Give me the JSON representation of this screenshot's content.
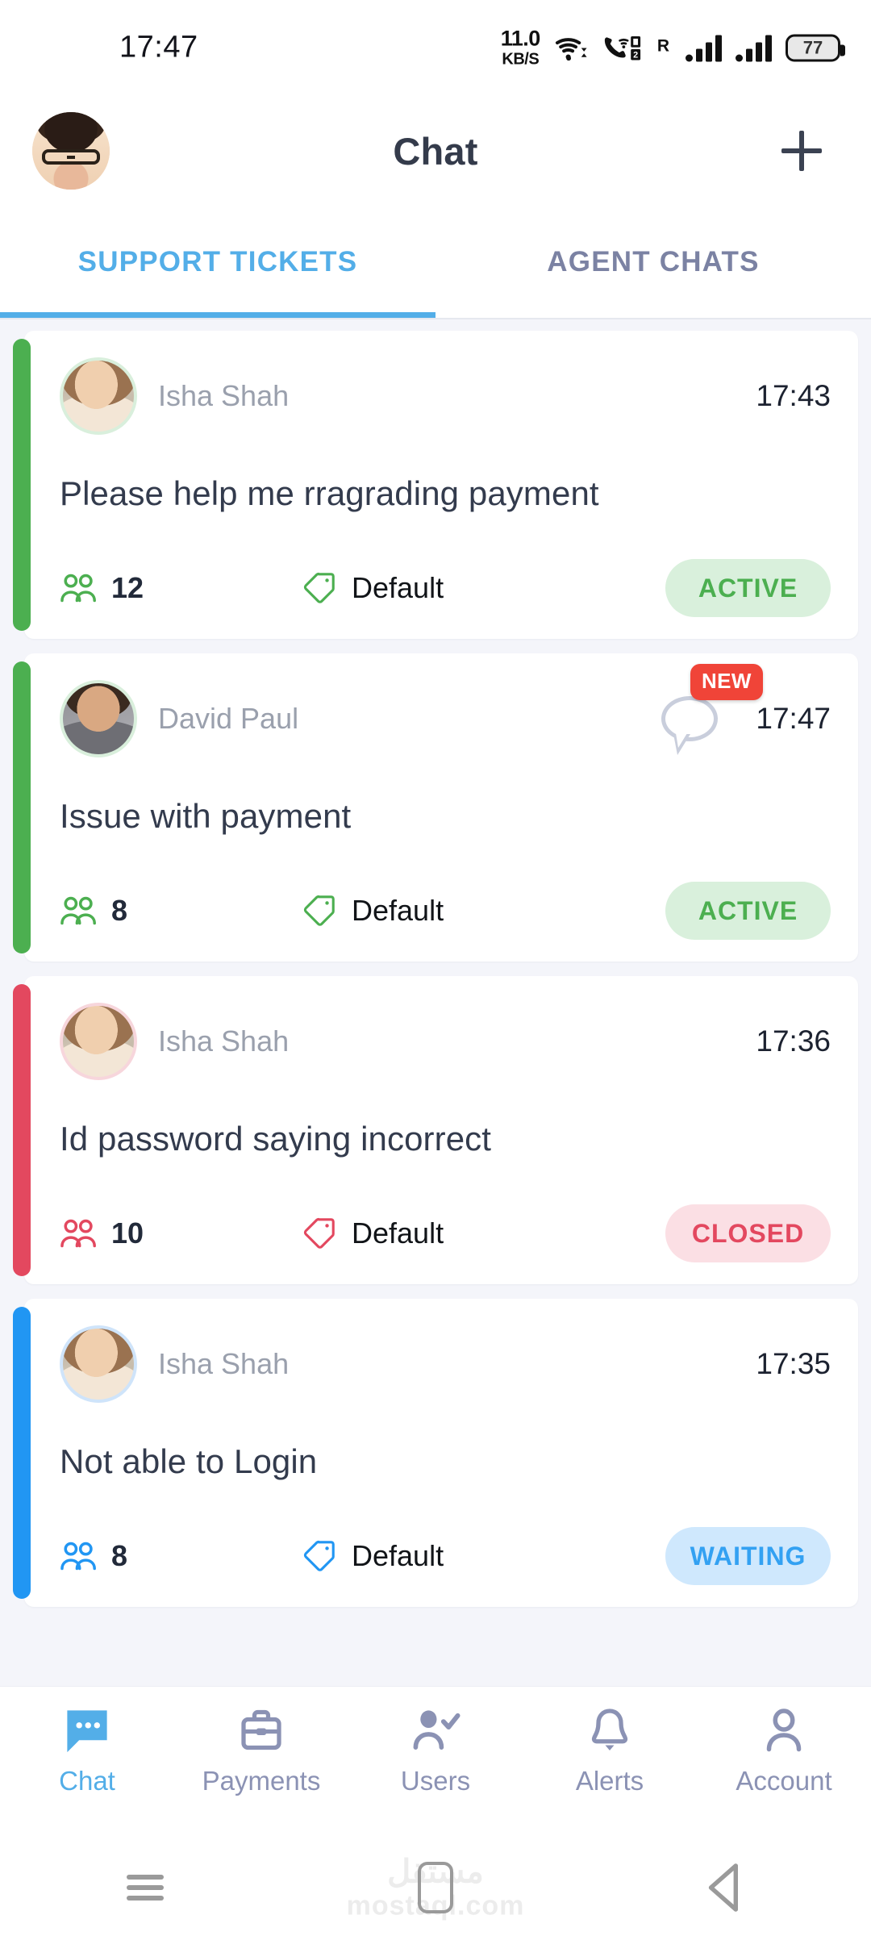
{
  "status_bar": {
    "clock": "17:47",
    "network_speed_value": "11.0",
    "network_speed_unit": "KB/S",
    "roaming_label": "R",
    "battery_percent": "77",
    "icons": [
      "wifi-icon",
      "wifi-calling-icon",
      "dual-sim-icon",
      "signal-bars-icon",
      "battery-icon"
    ]
  },
  "header": {
    "title": "Chat",
    "avatar_name": "profile-avatar",
    "add_button_label": "+"
  },
  "tabs": [
    {
      "label": "SUPPORT TICKETS",
      "active": true
    },
    {
      "label": "AGENT CHATS",
      "active": false
    }
  ],
  "colors": {
    "accent_blue": "#53aee8",
    "status_active_text": "#4caf50",
    "status_active_bg": "#d9f0dc",
    "status_closed_text": "#e3485f",
    "status_closed_bg": "#fbdfe4",
    "status_waiting_text": "#33a1f2",
    "status_waiting_bg": "#cfe8fd",
    "new_badge_bg": "#f04438",
    "page_bg": "#f4f5fa",
    "title_text": "#333b4d",
    "name_text": "#9aa0ad"
  },
  "tickets": [
    {
      "name": "Isha Shah",
      "time": "17:43",
      "title": "Please help me rragrading payment",
      "members": "12",
      "tag": "Default",
      "status": "ACTIVE",
      "accent": "#4caf50",
      "status_bg": "#d9f0dc",
      "status_color": "#4caf50",
      "avatar_ring": "#d9efdc",
      "has_new": false
    },
    {
      "name": "David Paul",
      "time": "17:47",
      "title": "Issue with payment",
      "members": "8",
      "tag": "Default",
      "status": "ACTIVE",
      "accent": "#4caf50",
      "status_bg": "#d9f0dc",
      "status_color": "#4caf50",
      "avatar_ring": "#d9efdc",
      "has_new": true,
      "new_label": "NEW"
    },
    {
      "name": "Isha Shah",
      "time": "17:36",
      "title": "Id password saying incorrect",
      "members": "10",
      "tag": "Default",
      "status": "CLOSED",
      "accent": "#e3485f",
      "status_bg": "#fbdfe4",
      "status_color": "#e3485f",
      "avatar_ring": "#f7d6dc",
      "has_new": false
    },
    {
      "name": "Isha Shah",
      "time": "17:35",
      "title": "Not able to Login",
      "members": "8",
      "tag": "Default",
      "status": "WAITING",
      "accent": "#2196f3",
      "status_bg": "#cfe8fd",
      "status_color": "#33a1f2",
      "avatar_ring": "#cfe4fa",
      "has_new": false
    }
  ],
  "bottom_nav": [
    {
      "label": "Chat",
      "icon": "chat-bubble-icon",
      "active": true
    },
    {
      "label": "Payments",
      "icon": "briefcase-icon",
      "active": false
    },
    {
      "label": "Users",
      "icon": "user-check-icon",
      "active": false
    },
    {
      "label": "Alerts",
      "icon": "bell-icon",
      "active": false
    },
    {
      "label": "Account",
      "icon": "person-icon",
      "active": false
    }
  ],
  "system_nav": {
    "menu": "recents-button",
    "home": "home-button",
    "back": "back-button",
    "watermark_ar": "مستقل",
    "watermark_en": "mostaql.com"
  }
}
